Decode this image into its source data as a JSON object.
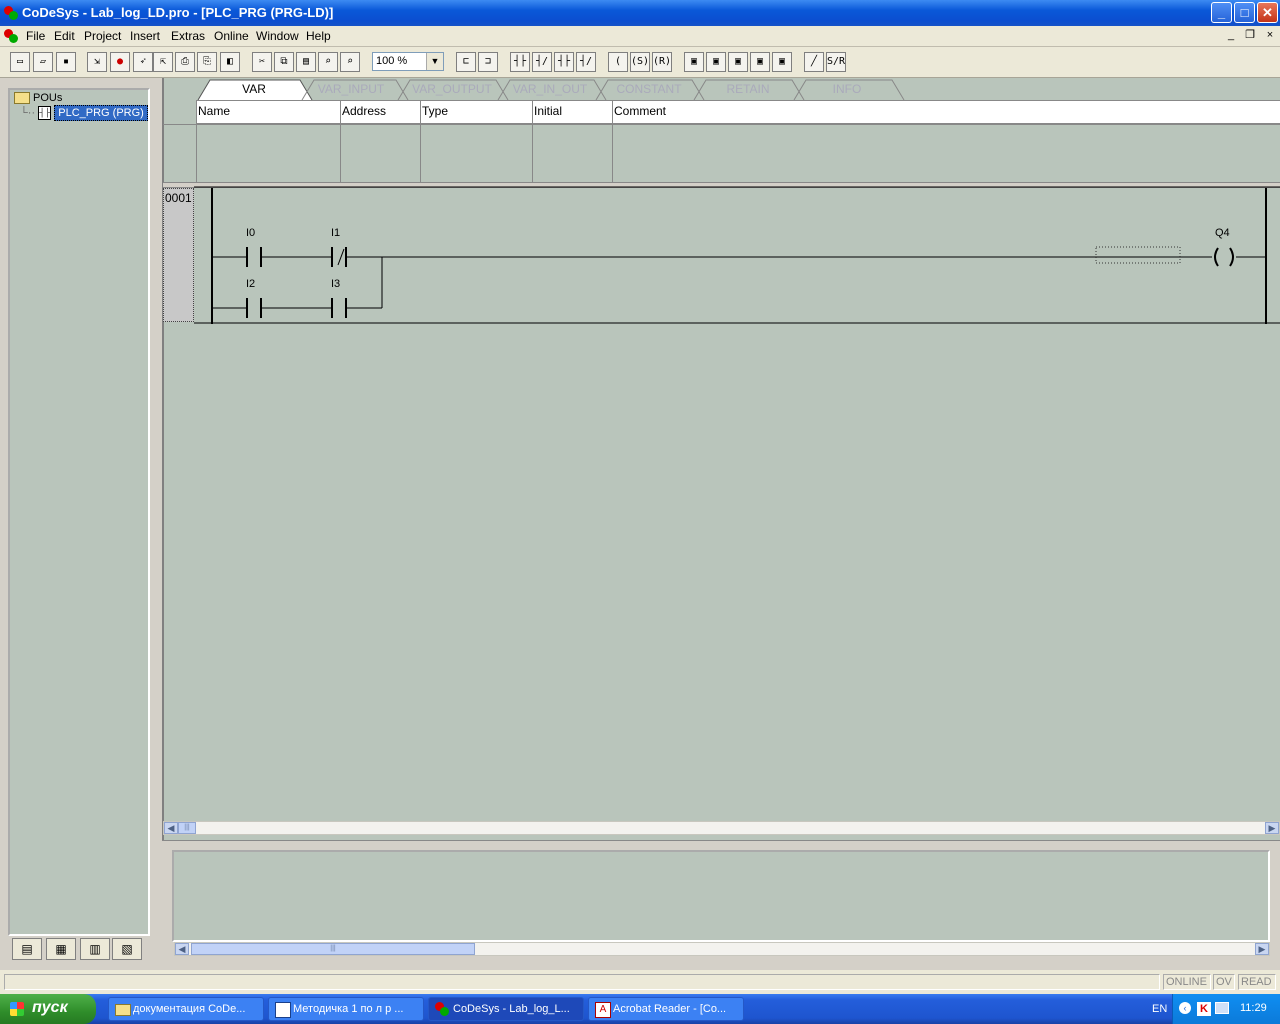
{
  "window": {
    "title": "CoDeSys - Lab_log_LD.pro - [PLC_PRG (PRG-LD)]",
    "buttons": {
      "minimize": "_",
      "maximize": "□",
      "close": "✕"
    }
  },
  "menu": {
    "items": [
      "File",
      "Edit",
      "Project",
      "Insert",
      "Extras",
      "Online",
      "Window",
      "Help"
    ],
    "mdi": {
      "minimize": "_",
      "restore": "❐",
      "close": "×"
    }
  },
  "toolbar": {
    "zoom_value": "100 %"
  },
  "tree": {
    "root_label": "POUs",
    "selected_item": "PLC_PRG (PRG)"
  },
  "var_tabs": [
    "VAR",
    "VAR_INPUT",
    "VAR_OUTPUT",
    "VAR_IN_OUT",
    "CONSTANT",
    "RETAIN",
    "INFO"
  ],
  "var_table": {
    "columns": [
      "Name",
      "Address",
      "Type",
      "Initial",
      "Comment"
    ]
  },
  "ladder": {
    "network_number": "0001",
    "contacts": [
      {
        "label": "I0",
        "type": "normally-open"
      },
      {
        "label": "I1",
        "type": "normally-closed"
      },
      {
        "label": "I2",
        "type": "normally-open"
      },
      {
        "label": "I3",
        "type": "normally-open"
      }
    ],
    "coil": {
      "label": "Q4",
      "symbol": "( )"
    }
  },
  "statusbar": {
    "online": "ONLINE",
    "ov": "OV",
    "read": "READ"
  },
  "taskbar": {
    "start_label": "пуск",
    "tasks": [
      "документация CoDe...",
      "Методичка 1 по л р ...",
      "CoDeSys - Lab_log_L...",
      "Acrobat Reader - [Co..."
    ],
    "language": "EN",
    "clock": "11:29"
  },
  "colors": {
    "titlebar": "#0a58d8",
    "editor_bg": "#b9c5bb",
    "selection": "#316ac5",
    "taskbar": "#245edb",
    "start_button": "#2f8d2a"
  }
}
